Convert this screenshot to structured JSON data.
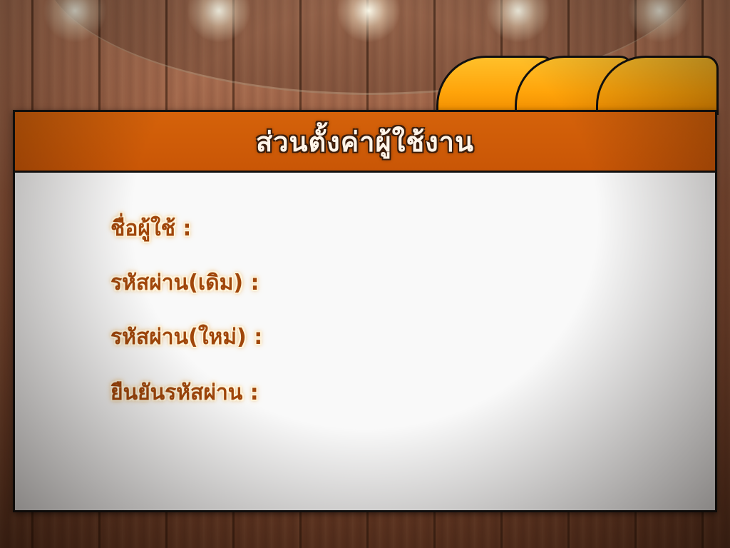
{
  "panel": {
    "title": "ส่วนตั้งค่าผู้ใช้งาน"
  },
  "form": {
    "fields": [
      {
        "label": "ชื่อผู้ใช้ :"
      },
      {
        "label": "รหัสผ่าน(เดิม) :"
      },
      {
        "label": "รหัสผ่าน(ใหม่) :"
      },
      {
        "label": "ยืนยันรหัสผ่าน :"
      }
    ]
  },
  "colors": {
    "header": "#d5620a",
    "tab": "#ffa40a",
    "label": "#a0460a",
    "panel_bg": "#f9f9f9"
  }
}
